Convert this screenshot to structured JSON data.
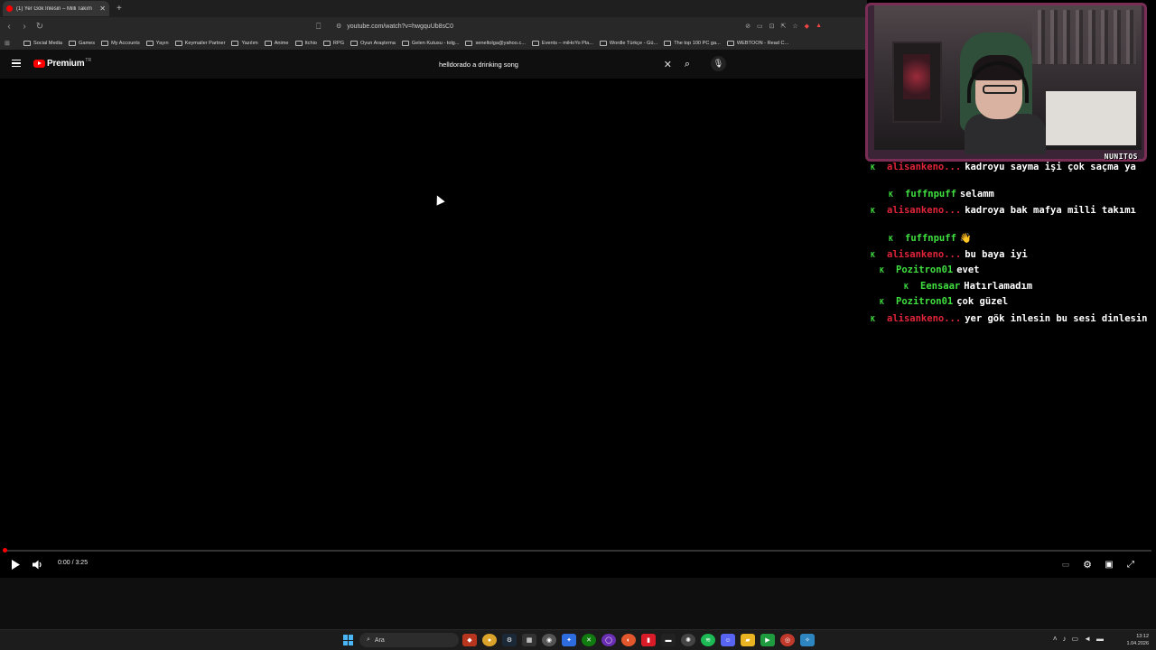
{
  "browser": {
    "tab_title": "(1) Yer Gök İnlesin – Milli Takım",
    "tab_close": "✕",
    "new_tab": "+",
    "url": "youtube.com/watch?v=hwgquUb8sC0",
    "bookmarks": [
      "Social Media",
      "Games",
      "My Accounts",
      "Yayın",
      "Keymailer Partner",
      "Yazılım",
      "Anime",
      "Itchio",
      "RPG",
      "Oyun Araştırma",
      "Gelen Kutusu - tolg...",
      "seneltolga@yahoo.c...",
      "Events – miHoYo Pla...",
      "Wordle Türkçe - Gü...",
      "The top 100 PC ga...",
      "WEBTOON - Read C..."
    ]
  },
  "youtube": {
    "logo_text": "Premium",
    "logo_sup": "TR",
    "search_query": "helldorado a drinking song",
    "clear_symbol": "✕",
    "search_symbol": "⌕",
    "mic_symbol": "🎙"
  },
  "player": {
    "time": "0:00 / 3:25",
    "progress_fraction": 0.0
  },
  "taskbar": {
    "search_label": "Ara",
    "clock_time": "13:12",
    "clock_date": "1.04.2026"
  },
  "webcam": {
    "brand": "NUNITOS"
  },
  "chat": {
    "badge_color": "#3fe03f",
    "messages": [
      {
        "user": "alisankeno...",
        "color": "#e0243a",
        "text": "kadroyu sayma işi çok saçma ya"
      },
      {
        "user": "fuffnpuff",
        "color": "#3fe03f",
        "text": "selamm"
      },
      {
        "user": "alisankeno...",
        "color": "#e0243a",
        "text": "kadroya bak mafya milli takımı"
      },
      {
        "user": "fuffnpuff",
        "color": "#3fe03f",
        "text": "👋"
      },
      {
        "user": "alisankeno...",
        "color": "#e0243a",
        "text": "bu baya iyi"
      },
      {
        "user": "Pozitron01",
        "color": "#3fe03f",
        "text": "evet"
      },
      {
        "user": "Eensaar",
        "color": "#3fe03f",
        "text": "Hatırlamadım"
      },
      {
        "user": "Pozitron01",
        "color": "#3fe03f",
        "text": "çok güzel"
      },
      {
        "user": "alisankeno...",
        "color": "#e0243a",
        "text": "yer gök inlesin bu sesi dinlesin"
      }
    ]
  }
}
